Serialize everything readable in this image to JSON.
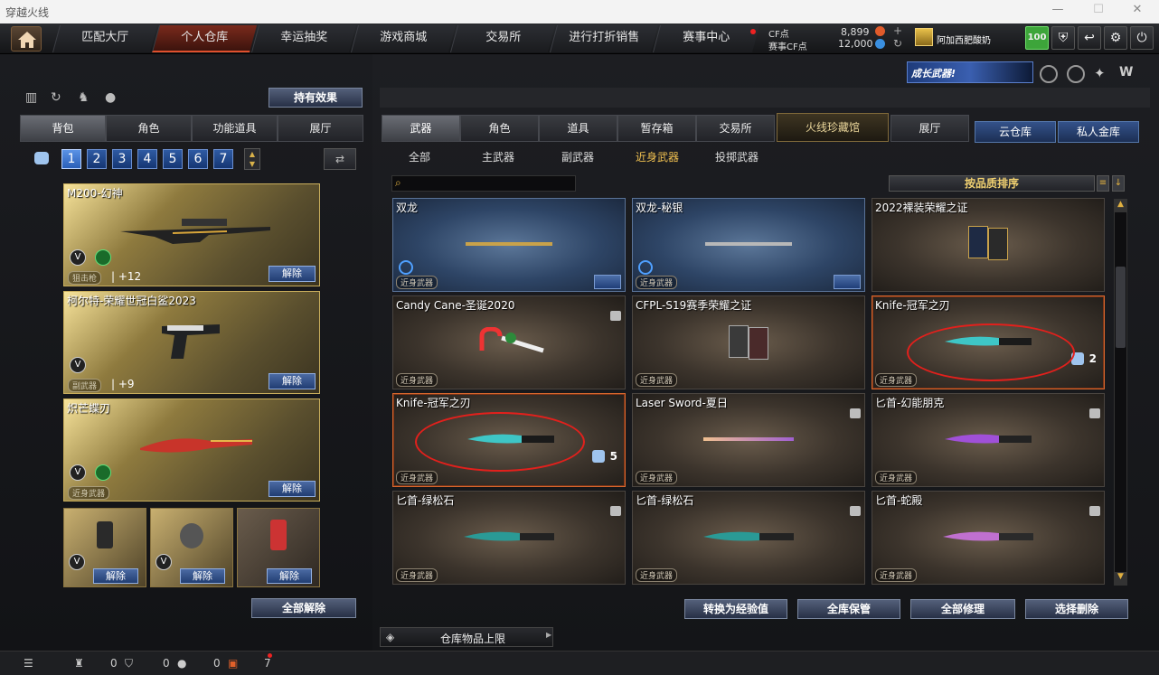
{
  "window": {
    "title": "穿越火线"
  },
  "nav": {
    "tabs": [
      "匹配大厅",
      "个人仓库",
      "幸运抽奖",
      "游戏商城",
      "交易所",
      "进行打折销售",
      "赛事中心"
    ]
  },
  "currency": {
    "cf_label": "CF点",
    "cf_value": "8,899",
    "match_cf_label": "赛事CF点",
    "match_cf_value": "12,000"
  },
  "user": {
    "name": "阿加西肥酸奶",
    "level": "100"
  },
  "banner": {
    "text": "成长武器!"
  },
  "left": {
    "effect_button": "持有效果",
    "tabs": [
      "背包",
      "角色",
      "功能道具",
      "展厅"
    ],
    "pages": [
      "1",
      "2",
      "3",
      "4",
      "5",
      "6",
      "7"
    ],
    "slots": [
      {
        "name": "M200-幻神",
        "category": "狙击枪",
        "plus": "+12",
        "unequip": "解除"
      },
      {
        "name": "柯尔特-荣耀世冠白鲨2023",
        "category": "副武器",
        "plus": "+9",
        "unequip": "解除"
      },
      {
        "name": "炽芒蝶刃",
        "category": "近身武器",
        "plus": "",
        "unequip": "解除"
      }
    ],
    "small_slots": [
      {
        "unequip": "解除"
      },
      {
        "unequip": "解除"
      },
      {
        "unequip": "解除"
      }
    ],
    "unequip_all": "全部解除"
  },
  "right": {
    "tabs": [
      "武器",
      "角色",
      "道具",
      "暂存箱",
      "交易所",
      "火线珍藏馆",
      "展厅"
    ],
    "cloud_tabs": [
      "云仓库",
      "私人金库"
    ],
    "subtabs": [
      "全部",
      "主武器",
      "副武器",
      "近身武器",
      "投掷武器"
    ],
    "search_placeholder": "",
    "sort_label": "按品质排序",
    "items": [
      {
        "name": "双龙",
        "category": "近身武器"
      },
      {
        "name": "双龙-秘银",
        "category": "近身武器"
      },
      {
        "name": "2022裸装荣耀之证",
        "category": ""
      },
      {
        "name": "Candy Cane-圣诞2020",
        "category": "近身武器"
      },
      {
        "name": "CFPL-S19赛季荣耀之证",
        "category": "近身武器"
      },
      {
        "name": "Knife-冠军之刃",
        "category": "近身武器",
        "count": "2"
      },
      {
        "name": "Knife-冠军之刃",
        "category": "近身武器",
        "count": "5"
      },
      {
        "name": "Laser Sword-夏日",
        "category": "近身武器"
      },
      {
        "name": "匕首-幻能朋克",
        "category": "近身武器"
      },
      {
        "name": "匕首-绿松石",
        "category": "近身武器"
      },
      {
        "name": "匕首-绿松石",
        "category": "近身武器"
      },
      {
        "name": "匕首-蛇殿",
        "category": "近身武器"
      }
    ],
    "actions": [
      "转换为经验值",
      "全库保管",
      "全部修理",
      "选择删除"
    ],
    "capacity_label": "仓库物品上限"
  },
  "bottom": {
    "count1": "0",
    "count2": "0",
    "count3": "0",
    "gift_count": "7"
  },
  "colors": {
    "accent": "#e0502d",
    "blue_button": "#2a4f8f",
    "gold_frame": "#c9ae5c"
  }
}
